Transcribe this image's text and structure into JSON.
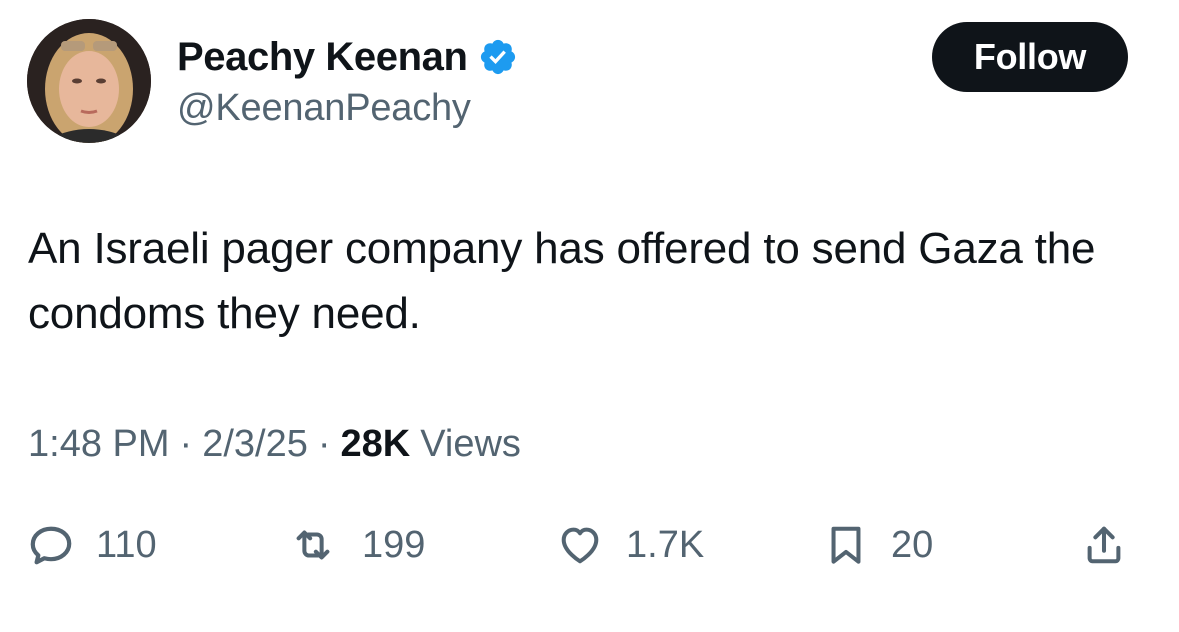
{
  "author": {
    "name": "Peachy Keenan",
    "handle": "@KeenanPeachy",
    "verified": true,
    "verified_icon": "verified-badge-icon",
    "verified_color": "#1d9bf0"
  },
  "follow_button": {
    "label": "Follow"
  },
  "tweet": {
    "text": "An Israeli pager company has offered to send Gaza the condoms they need."
  },
  "meta": {
    "time": "1:48 PM",
    "separator": "·",
    "date": "2/3/25",
    "views_count": "28K",
    "views_label": "Views"
  },
  "actions": {
    "reply": {
      "icon": "reply-icon",
      "count": "110"
    },
    "repost": {
      "icon": "repost-icon",
      "count": "199"
    },
    "like": {
      "icon": "heart-icon",
      "count": "1.7K"
    },
    "bookmark": {
      "icon": "bookmark-icon",
      "count": "20"
    },
    "share": {
      "icon": "share-icon"
    }
  },
  "colors": {
    "text_primary": "#0f1419",
    "text_secondary": "#536471",
    "button_bg": "#0f1419",
    "accent": "#1d9bf0"
  }
}
